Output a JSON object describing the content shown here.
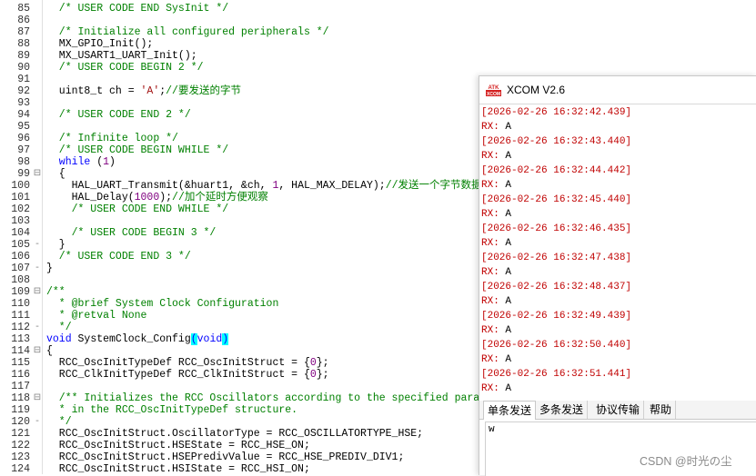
{
  "editor": {
    "lines": [
      {
        "n": "85",
        "fold": "",
        "segs": [
          [
            "c",
            "  /* USER CODE END SysInit */"
          ]
        ]
      },
      {
        "n": "86",
        "fold": "",
        "segs": []
      },
      {
        "n": "87",
        "fold": "",
        "segs": [
          [
            "c",
            "  /* Initialize all configured peripherals */"
          ]
        ]
      },
      {
        "n": "88",
        "fold": "",
        "segs": [
          [
            "p",
            "  MX_GPIO_Init();"
          ]
        ]
      },
      {
        "n": "89",
        "fold": "",
        "segs": [
          [
            "p",
            "  MX_USART1_UART_Init();"
          ]
        ]
      },
      {
        "n": "90",
        "fold": "",
        "segs": [
          [
            "c",
            "  /* USER CODE BEGIN 2 */"
          ]
        ]
      },
      {
        "n": "91",
        "fold": "",
        "segs": []
      },
      {
        "n": "92",
        "fold": "",
        "segs": [
          [
            "p",
            "  uint8_t ch = "
          ],
          [
            "s",
            "'A'"
          ],
          [
            "p",
            ";"
          ],
          [
            "c",
            "//要发送的字节"
          ]
        ]
      },
      {
        "n": "93",
        "fold": "",
        "segs": []
      },
      {
        "n": "94",
        "fold": "",
        "segs": [
          [
            "c",
            "  /* USER CODE END 2 */"
          ]
        ]
      },
      {
        "n": "95",
        "fold": "",
        "segs": []
      },
      {
        "n": "96",
        "fold": "",
        "segs": [
          [
            "c",
            "  /* Infinite loop */"
          ]
        ]
      },
      {
        "n": "97",
        "fold": "",
        "segs": [
          [
            "c",
            "  /* USER CODE BEGIN WHILE */"
          ]
        ]
      },
      {
        "n": "98",
        "fold": "",
        "segs": [
          [
            "k",
            "  while"
          ],
          [
            "p",
            " ("
          ],
          [
            "n",
            "1"
          ],
          [
            "p",
            ")"
          ]
        ]
      },
      {
        "n": "99",
        "fold": "⊟",
        "segs": [
          [
            "p",
            "  {"
          ]
        ]
      },
      {
        "n": "100",
        "fold": "",
        "segs": [
          [
            "p",
            "    HAL_UART_Transmit(&huart1, &ch, "
          ],
          [
            "n",
            "1"
          ],
          [
            "p",
            ", HAL_MAX_DELAY);"
          ],
          [
            "c",
            "//发送一个字节数据"
          ]
        ]
      },
      {
        "n": "101",
        "fold": "",
        "segs": [
          [
            "p",
            "    HAL_Delay("
          ],
          [
            "n",
            "1000"
          ],
          [
            "p",
            ");"
          ],
          [
            "c",
            "//加个延时方便观察"
          ]
        ]
      },
      {
        "n": "102",
        "fold": "",
        "segs": [
          [
            "c",
            "    /* USER CODE END WHILE */"
          ]
        ]
      },
      {
        "n": "103",
        "fold": "",
        "segs": []
      },
      {
        "n": "104",
        "fold": "",
        "segs": [
          [
            "c",
            "    /* USER CODE BEGIN 3 */"
          ]
        ]
      },
      {
        "n": "105",
        "fold": "-",
        "segs": [
          [
            "p",
            "  }"
          ]
        ]
      },
      {
        "n": "106",
        "fold": "",
        "segs": [
          [
            "c",
            "  /* USER CODE END 3 */"
          ]
        ]
      },
      {
        "n": "107",
        "fold": "-",
        "segs": [
          [
            "p",
            "}"
          ]
        ]
      },
      {
        "n": "108",
        "fold": "",
        "segs": []
      },
      {
        "n": "109",
        "fold": "⊟",
        "segs": [
          [
            "c",
            "/**"
          ]
        ]
      },
      {
        "n": "110",
        "fold": "",
        "segs": [
          [
            "c",
            "  * @brief System Clock Configuration"
          ]
        ]
      },
      {
        "n": "111",
        "fold": "",
        "segs": [
          [
            "c",
            "  * @retval None"
          ]
        ]
      },
      {
        "n": "112",
        "fold": "-",
        "segs": [
          [
            "c",
            "  */"
          ]
        ]
      },
      {
        "n": "113",
        "fold": "",
        "segs": [
          [
            "k",
            "void"
          ],
          [
            "p",
            " SystemClock_Config"
          ],
          [
            "h",
            "("
          ],
          [
            "k",
            "void"
          ],
          [
            "h",
            ")"
          ]
        ]
      },
      {
        "n": "114",
        "fold": "⊟",
        "segs": [
          [
            "p",
            "{"
          ]
        ]
      },
      {
        "n": "115",
        "fold": "",
        "segs": [
          [
            "p",
            "  RCC_OscInitTypeDef RCC_OscInitStruct = {"
          ],
          [
            "n",
            "0"
          ],
          [
            "p",
            "};"
          ]
        ]
      },
      {
        "n": "116",
        "fold": "",
        "segs": [
          [
            "p",
            "  RCC_ClkInitTypeDef RCC_ClkInitStruct = {"
          ],
          [
            "n",
            "0"
          ],
          [
            "p",
            "};"
          ]
        ]
      },
      {
        "n": "117",
        "fold": "",
        "segs": []
      },
      {
        "n": "118",
        "fold": "⊟",
        "segs": [
          [
            "c",
            "  /** Initializes the RCC Oscillators according to the specified parameters"
          ]
        ]
      },
      {
        "n": "119",
        "fold": "",
        "segs": [
          [
            "c",
            "  * in the RCC_OscInitTypeDef structure."
          ]
        ]
      },
      {
        "n": "120",
        "fold": "-",
        "segs": [
          [
            "c",
            "  */"
          ]
        ]
      },
      {
        "n": "121",
        "fold": "",
        "segs": [
          [
            "p",
            "  RCC_OscInitStruct.OscillatorType = RCC_OSCILLATORTYPE_HSE;"
          ]
        ]
      },
      {
        "n": "122",
        "fold": "",
        "segs": [
          [
            "p",
            "  RCC_OscInitStruct.HSEState = RCC_HSE_ON;"
          ]
        ]
      },
      {
        "n": "123",
        "fold": "",
        "segs": [
          [
            "p",
            "  RCC_OscInitStruct.HSEPredivValue = RCC_HSE_PREDIV_DIV1;"
          ]
        ]
      },
      {
        "n": "124",
        "fold": "",
        "segs": [
          [
            "p",
            "  RCC_OscInitStruct.HSIState = RCC_HSI_ON;"
          ]
        ]
      }
    ]
  },
  "xcom": {
    "title": "XCOM V2.6",
    "logo_text": "ATK XCOM",
    "rx_entries": [
      {
        "ts": "[2026-02-26 16:32:42.439]",
        "tag": "RX:",
        "val": "A"
      },
      {
        "ts": "[2026-02-26 16:32:43.440]",
        "tag": "RX:",
        "val": "A"
      },
      {
        "ts": "[2026-02-26 16:32:44.442]",
        "tag": "RX:",
        "val": "A"
      },
      {
        "ts": "[2026-02-26 16:32:45.440]",
        "tag": "RX:",
        "val": "A"
      },
      {
        "ts": "[2026-02-26 16:32:46.435]",
        "tag": "RX:",
        "val": "A"
      },
      {
        "ts": "[2026-02-26 16:32:47.438]",
        "tag": "RX:",
        "val": "A"
      },
      {
        "ts": "[2026-02-26 16:32:48.437]",
        "tag": "RX:",
        "val": "A"
      },
      {
        "ts": "[2026-02-26 16:32:49.439]",
        "tag": "RX:",
        "val": "A"
      },
      {
        "ts": "[2026-02-26 16:32:50.440]",
        "tag": "RX:",
        "val": "A"
      },
      {
        "ts": "[2026-02-26 16:32:51.441]",
        "tag": "RX:",
        "val": "A"
      }
    ],
    "tabs": [
      "单条发送",
      "多条发送",
      "协议传输",
      "帮助"
    ],
    "send_text": "w",
    "colors": {
      "timestamp": "#c00000",
      "rx_tag": "#c00000",
      "logo_red": "#d42020"
    }
  },
  "watermark": "CSDN @时光の尘"
}
